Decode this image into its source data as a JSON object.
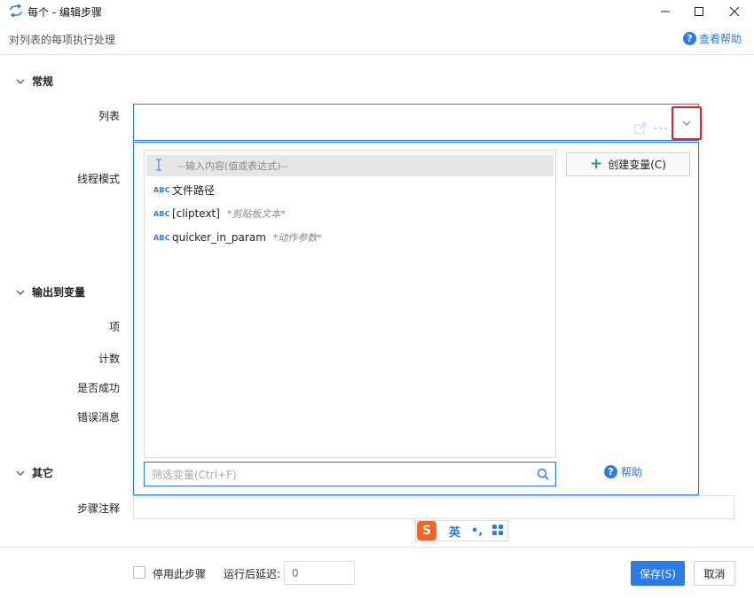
{
  "window": {
    "title": "每个 - 编辑步骤",
    "subtitle": "对列表的每项执行处理",
    "help_link": "查看帮助"
  },
  "sections": {
    "general": "常规",
    "output": "输出到变量",
    "other": "其它"
  },
  "labels": {
    "list": "列表",
    "thread_mode": "线程模式",
    "item": "项",
    "count": "计数",
    "success": "是否成功",
    "error_message": "错误消息",
    "step_note": "步骤注释"
  },
  "dropdown": {
    "items": [
      {
        "name": "--输入内容(值或表达式)--",
        "desc": ""
      },
      {
        "name": "文件路径",
        "desc": ""
      },
      {
        "name": "[cliptext]",
        "desc": "*剪贴板文本*"
      },
      {
        "name": "quicker_in_param",
        "desc": "*动作参数*"
      }
    ],
    "type_badge": "ABC",
    "create_var_label": "创建变量(C)",
    "filter_placeholder": "筛选变量(Ctrl+F)",
    "help_label": "帮助"
  },
  "ime": {
    "logo": "S",
    "lang": "英",
    "punctuation": "•,"
  },
  "footer": {
    "disable_label": "停用此步骤",
    "delay_label": "运行后延迟:",
    "delay_value": "0",
    "save_label": "保存(S)",
    "cancel_label": "取消"
  },
  "colors": {
    "accent": "#2d7be5",
    "highlight_border": "#e02020",
    "plus_green": "#1ba84b",
    "ime_orange": "#f26522"
  }
}
